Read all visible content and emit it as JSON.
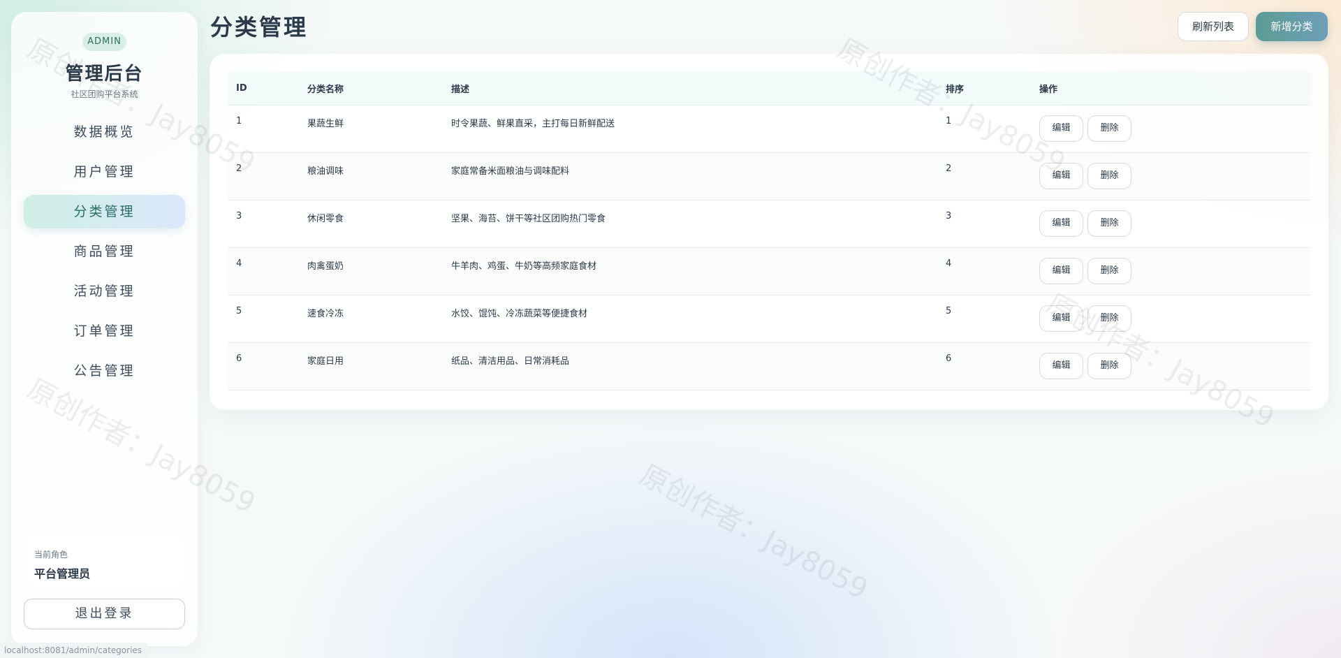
{
  "sidebar": {
    "badge": "ADMIN",
    "title": "管理后台",
    "subtitle": "社区团购平台系统",
    "items": [
      {
        "label": "数据概览"
      },
      {
        "label": "用户管理"
      },
      {
        "label": "分类管理",
        "active": true
      },
      {
        "label": "商品管理"
      },
      {
        "label": "活动管理"
      },
      {
        "label": "订单管理"
      },
      {
        "label": "公告管理"
      }
    ],
    "role_label": "当前角色",
    "role_name": "平台管理员",
    "logout_label": "退出登录"
  },
  "header": {
    "title": "分类管理",
    "refresh_label": "刷新列表",
    "add_label": "新增分类"
  },
  "table": {
    "columns": [
      "ID",
      "分类名称",
      "描述",
      "排序",
      "操作"
    ],
    "rows": [
      {
        "id": "1",
        "name": "果蔬生鲜",
        "desc": "时令果蔬、鲜果直采，主打每日新鲜配送",
        "sort": "1"
      },
      {
        "id": "2",
        "name": "粮油调味",
        "desc": "家庭常备米面粮油与调味配料",
        "sort": "2"
      },
      {
        "id": "3",
        "name": "休闲零食",
        "desc": "坚果、海苔、饼干等社区团购热门零食",
        "sort": "3"
      },
      {
        "id": "4",
        "name": "肉禽蛋奶",
        "desc": "牛羊肉、鸡蛋、牛奶等高频家庭食材",
        "sort": "4"
      },
      {
        "id": "5",
        "name": "速食冷冻",
        "desc": "水饺、馄饨、冷冻蔬菜等便捷食材",
        "sort": "5"
      },
      {
        "id": "6",
        "name": "家庭日用",
        "desc": "纸品、清洁用品、日常消耗品",
        "sort": "6"
      }
    ],
    "edit_label": "编辑",
    "delete_label": "删除"
  },
  "watermark": "原创作者：Jay8059",
  "status_url": "localhost:8081/admin/categories",
  "colors": {
    "accent": "#5c9c94",
    "active_nav_start": "#cfeee4",
    "active_nav_end": "#d9e8fb",
    "text": "#2b3a4a"
  }
}
